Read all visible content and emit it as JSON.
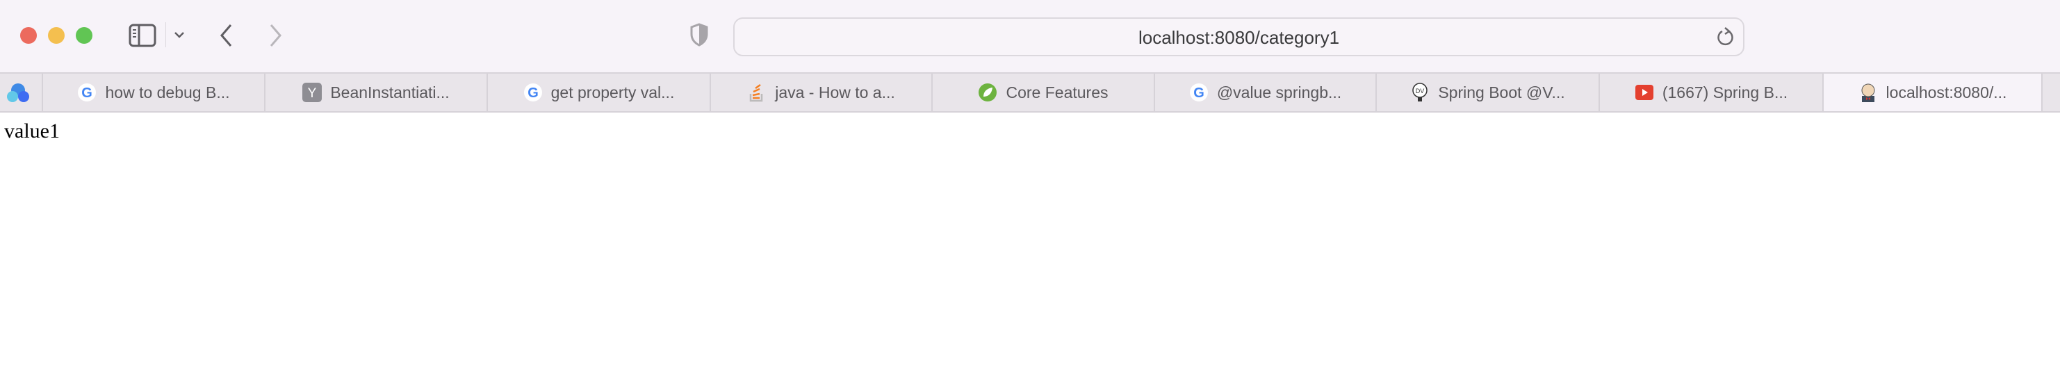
{
  "browser": {
    "address_bar": {
      "url": "localhost:8080/category1"
    },
    "traffic_lights": {
      "close": "#ec6a5e",
      "minimize": "#f4bf4f",
      "zoom": "#61c554"
    },
    "tabs": [
      {
        "label": "how to debug B...",
        "icon": "google-icon",
        "active": false
      },
      {
        "label": "BeanInstantiati...",
        "icon": "y-combinator-icon",
        "active": false
      },
      {
        "label": "get property val...",
        "icon": "google-icon",
        "active": false
      },
      {
        "label": "java - How to a...",
        "icon": "stackoverflow-icon",
        "active": false
      },
      {
        "label": "Core Features",
        "icon": "spring-icon",
        "active": false
      },
      {
        "label": "@value springb...",
        "icon": "google-icon",
        "active": false
      },
      {
        "label": "Spring Boot @V...",
        "icon": "lightbulb-icon",
        "active": false
      },
      {
        "label": "(1667) Spring B...",
        "icon": "youtube-icon",
        "active": false
      },
      {
        "label": "localhost:8080/...",
        "icon": "jenkins-icon",
        "active": true
      }
    ]
  },
  "page": {
    "text": "value1"
  }
}
